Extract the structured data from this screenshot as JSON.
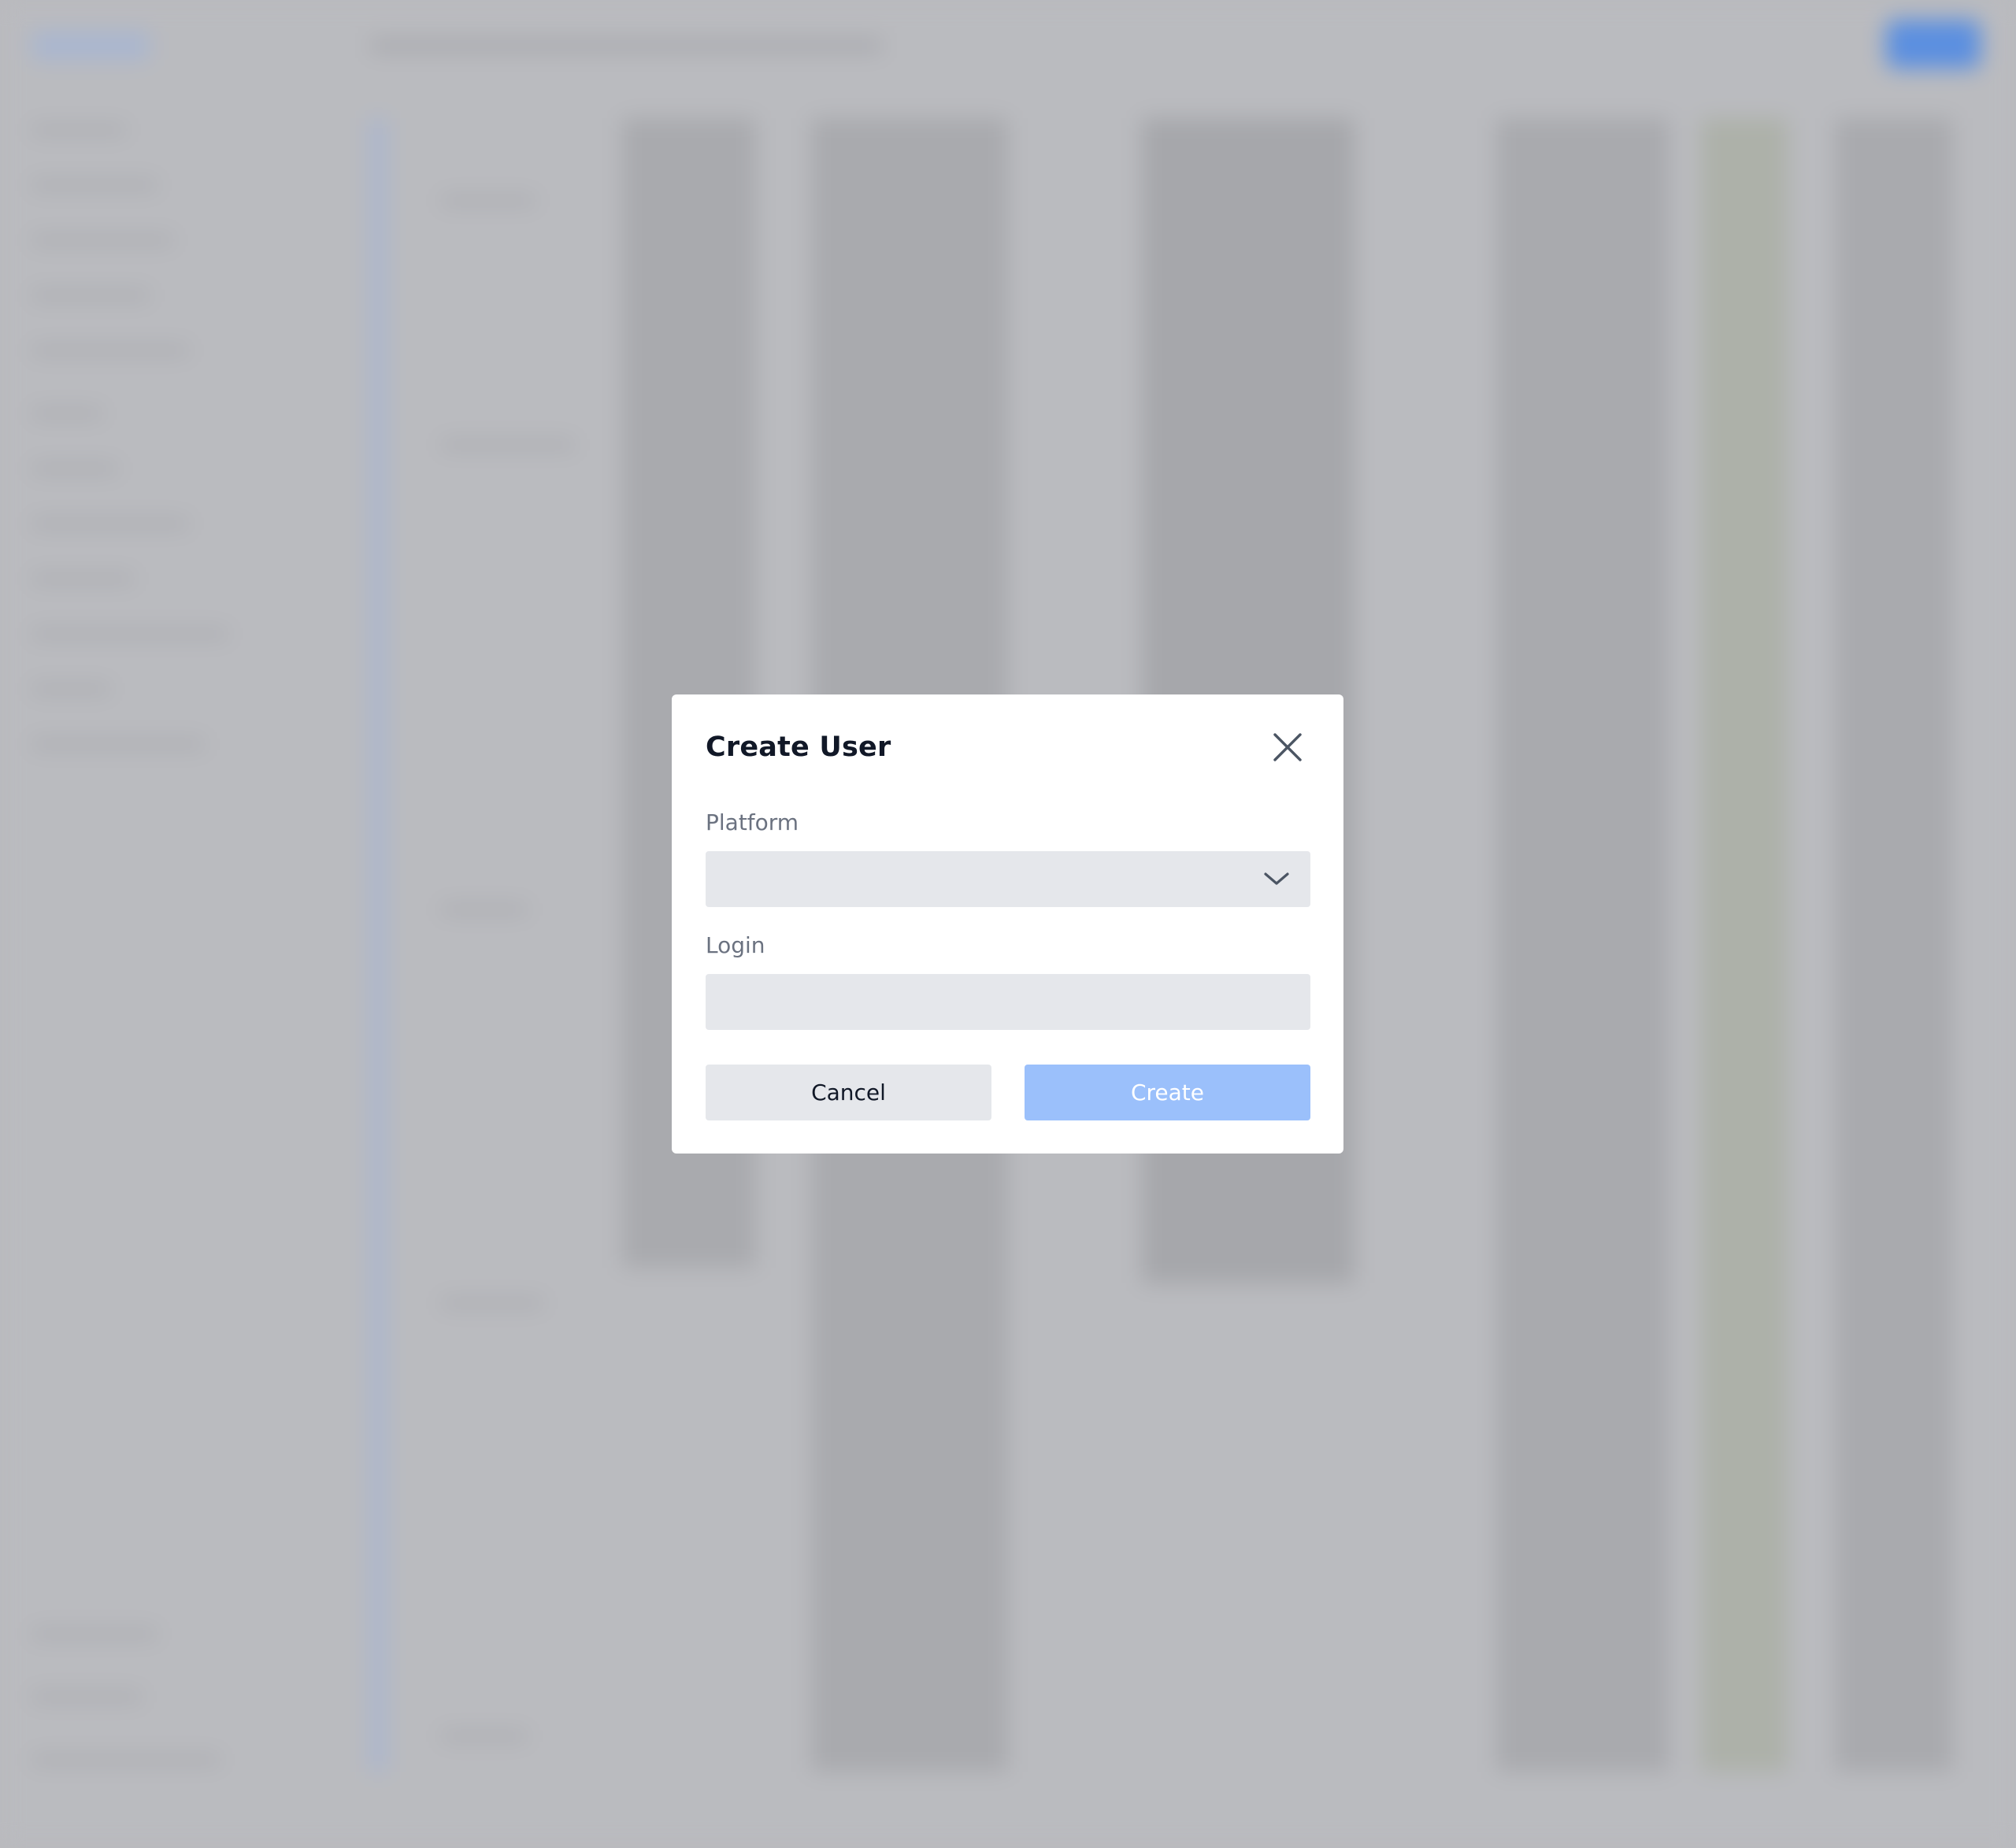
{
  "modal": {
    "title": "Create User",
    "close_icon": "close-icon",
    "platform": {
      "label": "Platform",
      "selected_value": "",
      "dropdown_icon": "chevron-down-icon"
    },
    "login": {
      "label": "Login",
      "value": "",
      "placeholder": ""
    },
    "cancel_label": "Cancel",
    "create_label": "Create"
  },
  "colors": {
    "overlay": "#b9babe",
    "modal_bg": "#ffffff",
    "input_bg": "#e5e7eb",
    "create_button_disabled": "#9bc0fb",
    "title_text": "#111827",
    "label_text": "#6b7280"
  }
}
